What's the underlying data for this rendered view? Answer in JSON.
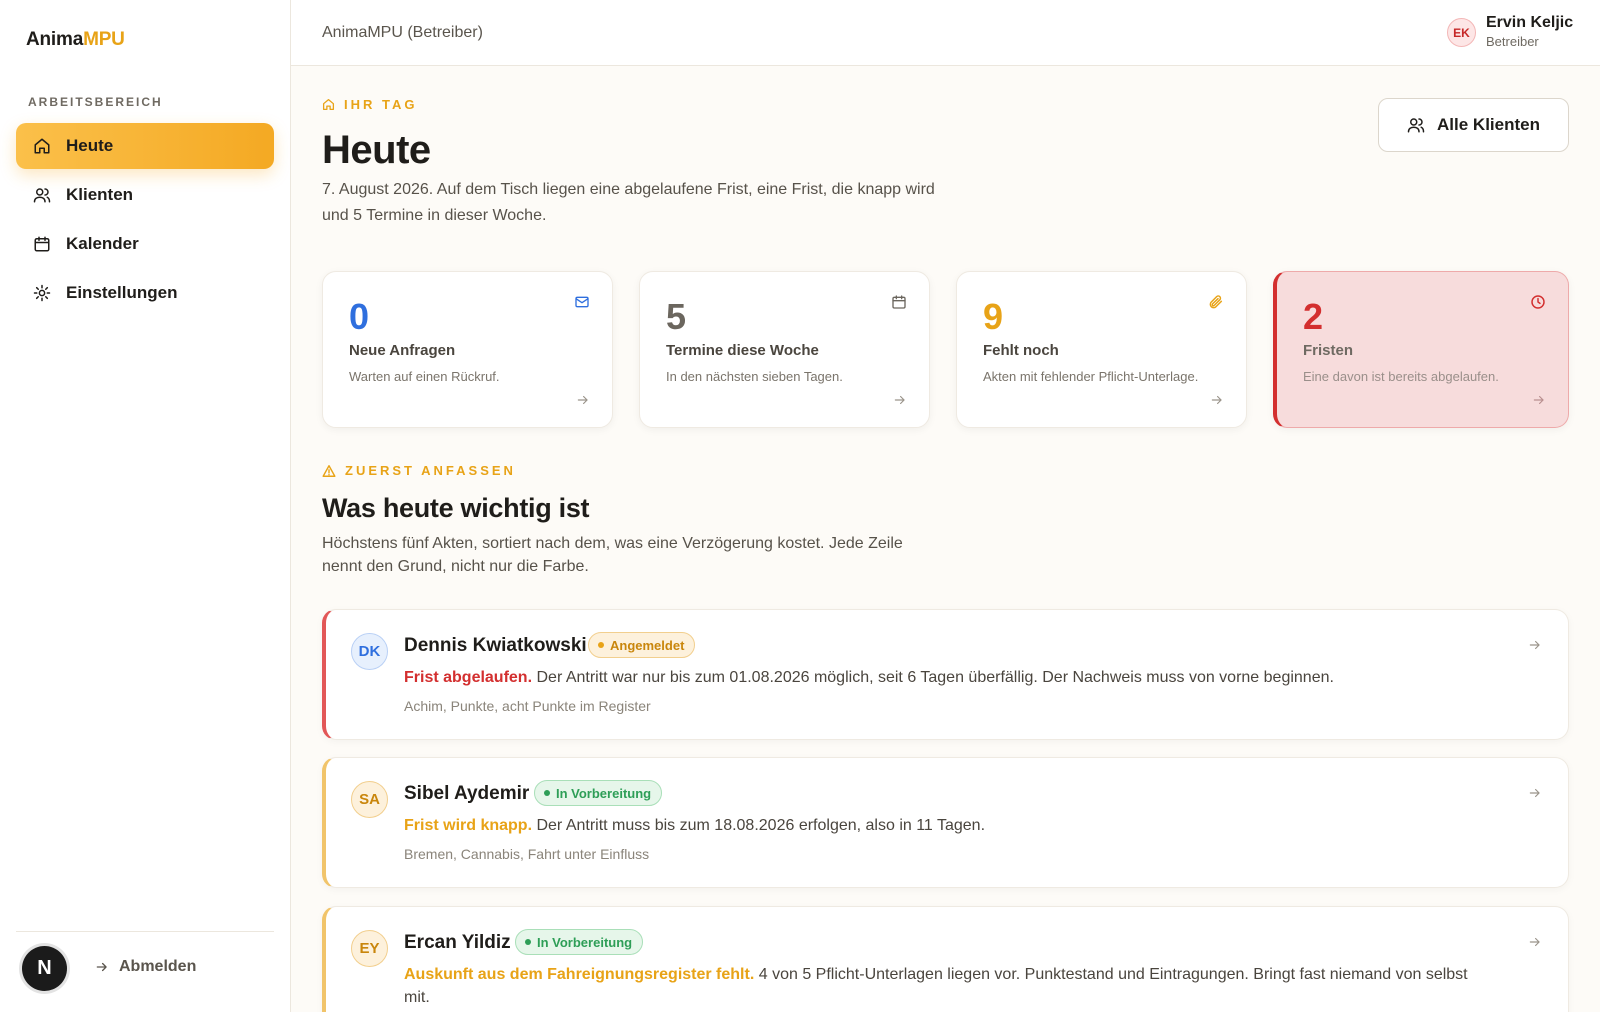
{
  "brand": {
    "name": "Anima",
    "accent": "MPU"
  },
  "sidebar": {
    "section_label": "ARBEITSBEREICH",
    "items": [
      {
        "label": "Heute",
        "icon": "home-icon",
        "active": true
      },
      {
        "label": "Klienten",
        "icon": "users-icon",
        "active": false
      },
      {
        "label": "Kalender",
        "icon": "calendar-icon",
        "active": false
      },
      {
        "label": "Einstellungen",
        "icon": "gear-icon",
        "active": false
      }
    ],
    "avatar_letter": "N",
    "logout_label": "Abmelden"
  },
  "topbar": {
    "title": "AnimaMPU (Betreiber)",
    "user": {
      "initials": "EK",
      "name": "Ervin Keljic",
      "role": "Betreiber"
    }
  },
  "header": {
    "eyebrow": "IHR TAG",
    "title": "Heute",
    "lead": "7. August 2026. Auf dem Tisch liegen eine abgelaufene Frist, eine Frist, die knapp wird und 5 Termine in dieser Woche.",
    "all_clients_label": "Alle Klienten"
  },
  "stats": [
    {
      "value": "0",
      "label": "Neue Anfragen",
      "desc": "Warten auf einen Rückruf.",
      "icon": "mail-icon",
      "color": "#2f6fde"
    },
    {
      "value": "5",
      "label": "Termine diese Woche",
      "desc": "In den nächsten sieben Tagen.",
      "icon": "calendar-icon",
      "color": "#6b665e"
    },
    {
      "value": "9",
      "label": "Fehlt noch",
      "desc": "Akten mit fehlender Pflicht-Unterlage.",
      "icon": "paperclip-icon",
      "color": "#e8a317"
    },
    {
      "value": "2",
      "label": "Fristen",
      "desc": "Eine davon ist bereits abgelaufen.",
      "icon": "clock-icon",
      "color": "#d32f2f"
    }
  ],
  "priority": {
    "eyebrow": "ZUERST ANFASSEN",
    "title": "Was heute wichtig ist",
    "lead": "Höchstens fünf Akten, sortiert nach dem, was eine Verzögerung kostet. Jede Zeile nennt den Grund, nicht nur die Farbe.",
    "items": [
      {
        "initials": "DK",
        "name": "Dennis Kwiatkowski",
        "status": "Angemeldet",
        "reason": "Frist abgelaufen.",
        "detail": "Der Antritt war nur bis zum 01.08.2026 möglich, seit 6 Tagen überfällig. Der Nachweis muss von vorne beginnen.",
        "meta": "Achim, Punkte, acht Punkte im Register"
      },
      {
        "initials": "SA",
        "name": "Sibel Aydemir",
        "status": "In Vorbereitung",
        "reason": "Frist wird knapp.",
        "detail": "Der Antritt muss bis zum 18.08.2026 erfolgen, also in 11 Tagen.",
        "meta": "Bremen, Cannabis, Fahrt unter Einfluss"
      },
      {
        "initials": "EY",
        "name": "Ercan Yildiz",
        "status": "In Vorbereitung",
        "reason": "Auskunft aus dem Fahreignungsregister fehlt.",
        "detail": "4 von 5 Pflicht-Unterlagen liegen vor. Punktestand und Eintragungen. Bringt fast niemand von selbst mit.",
        "meta": ""
      }
    ]
  },
  "colors": {
    "accent": "#e8a317",
    "danger": "#d32f2f",
    "success": "#2e9e57",
    "info": "#2f6fde"
  }
}
